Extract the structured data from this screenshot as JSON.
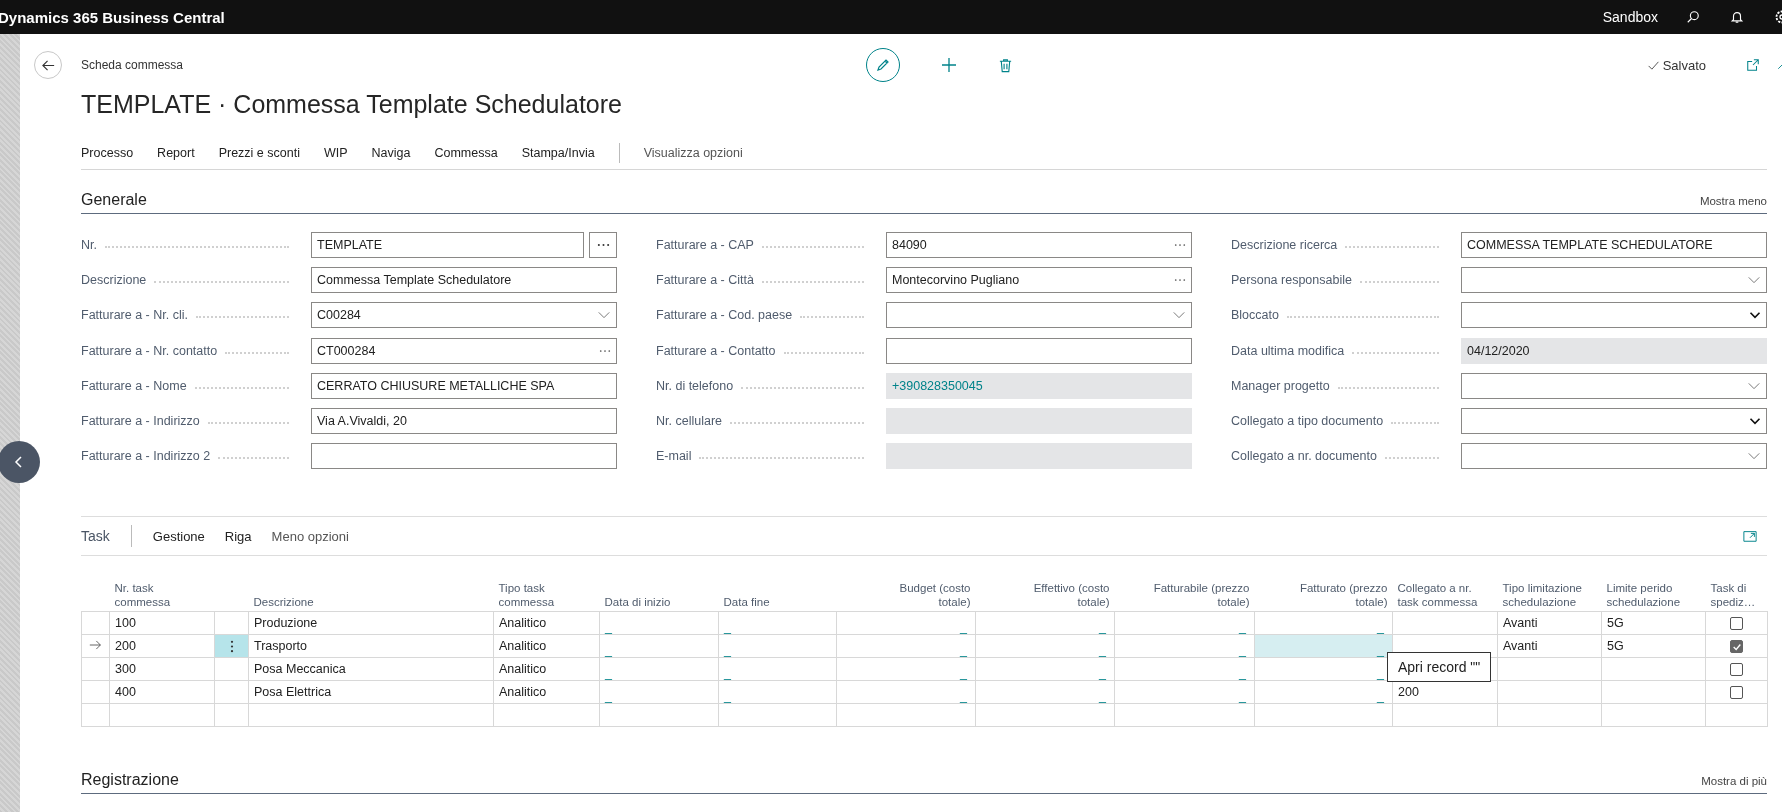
{
  "app_bar": {
    "product": "Dynamics 365 Business Central",
    "environment": "Sandbox"
  },
  "header": {
    "breadcrumb": "Scheda commessa",
    "title": "TEMPLATE · Commessa Template Schedulatore",
    "status": "Salvato"
  },
  "action_bar": {
    "actions": [
      "Processo",
      "Report",
      "Prezzi e sconti",
      "WIP",
      "Naviga",
      "Commessa",
      "Stampa/Invia"
    ],
    "options": "Visualizza opzioni"
  },
  "general": {
    "title": "Generale",
    "toggle": "Mostra meno",
    "columns": [
      [
        {
          "label": "Nr.",
          "value": "TEMPLATE",
          "kind": "assist_button"
        },
        {
          "label": "Descrizione",
          "value": "Commessa Template Schedulatore",
          "kind": "text"
        },
        {
          "label": "Fatturare a - Nr. cli.",
          "value": "C00284",
          "kind": "dropdown"
        },
        {
          "label": "Fatturare a - Nr. contatto",
          "value": "CT000284",
          "kind": "assist"
        },
        {
          "label": "Fatturare a - Nome",
          "value": "CERRATO CHIUSURE METALLICHE SPA",
          "kind": "text"
        },
        {
          "label": "Fatturare a - Indirizzo",
          "value": "Via A.Vivaldi, 20",
          "kind": "text"
        },
        {
          "label": "Fatturare a - Indirizzo 2",
          "kind": "text"
        }
      ],
      [
        {
          "label": "Fatturare a - CAP",
          "value": "84090",
          "kind": "assist"
        },
        {
          "label": "Fatturare a - Città",
          "value": "Montecorvino Pugliano",
          "kind": "assist"
        },
        {
          "label": "Fatturare a - Cod. paese",
          "kind": "dropdown"
        },
        {
          "label": "Fatturare a - Contatto",
          "kind": "text"
        },
        {
          "label": "Nr. di telefono",
          "value": "+390828350045",
          "kind": "readonly_link"
        },
        {
          "label": "Nr. cellulare",
          "kind": "readonly"
        },
        {
          "label": "E-mail",
          "kind": "readonly"
        }
      ],
      [
        {
          "label": "Descrizione ricerca",
          "value": "COMMESSA TEMPLATE SCHEDULATORE",
          "kind": "text"
        },
        {
          "label": "Persona responsabile",
          "kind": "dropdown"
        },
        {
          "label": "Bloccato",
          "kind": "select"
        },
        {
          "label": "Data ultima modifica",
          "value": "04/12/2020",
          "kind": "readonly"
        },
        {
          "label": "Manager progetto",
          "kind": "dropdown"
        },
        {
          "label": "Collegato a tipo documento",
          "kind": "select"
        },
        {
          "label": "Collegato a nr. documento",
          "kind": "dropdown"
        }
      ]
    ]
  },
  "task": {
    "title": "Task",
    "actions": [
      "Gestione",
      "Riga"
    ],
    "more": "Meno opzioni",
    "tooltip": "Apri record \"\"",
    "columns": [
      {
        "label": "Nr. task commessa",
        "kind": "text"
      },
      {
        "label": "Descrizione",
        "kind": "text"
      },
      {
        "label": "Tipo task commessa",
        "kind": "text"
      },
      {
        "label": "Data di inizio",
        "kind": "date"
      },
      {
        "label": "Data fine",
        "kind": "date"
      },
      {
        "label": "Budget (costo totale)",
        "kind": "amount"
      },
      {
        "label": "Effettivo (costo totale)",
        "kind": "amount"
      },
      {
        "label": "Fatturabile (prezzo totale)",
        "kind": "amount"
      },
      {
        "label": "Fatturato (prezzo totale)",
        "kind": "amount",
        "focused": true
      },
      {
        "label": "Collegato a nr. task commessa",
        "kind": "text"
      },
      {
        "label": "Tipo limitazione schedulazione",
        "kind": "text"
      },
      {
        "label": "Limite perido schedulazione",
        "kind": "text"
      },
      {
        "label": "Task di spediz…",
        "kind": "checkbox"
      }
    ],
    "rows": [
      {
        "selected": false,
        "no": "100",
        "description": "Produzione",
        "type": "Analitico",
        "start": "_",
        "end": "_",
        "budget": "_",
        "actual": "_",
        "billable": "_",
        "invoiced": "_",
        "limit_type": "Avanti",
        "limit_period": "5G",
        "shipping": false
      },
      {
        "selected": true,
        "no": "200",
        "description": "Trasporto",
        "type": "Analitico",
        "start": "_",
        "end": "_",
        "budget": "_",
        "actual": "_",
        "billable": "_",
        "invoiced": "_",
        "limit_type": "Avanti",
        "limit_period": "5G",
        "shipping": true
      },
      {
        "selected": false,
        "no": "300",
        "description": "Posa Meccanica",
        "type": "Analitico",
        "start": "_",
        "end": "_",
        "budget": "_",
        "actual": "_",
        "billable": "_",
        "invoiced": "_",
        "shipping": false
      },
      {
        "selected": false,
        "no": "400",
        "description": "Posa Elettrica",
        "type": "Analitico",
        "start": "_",
        "end": "_",
        "budget": "_",
        "actual": "_",
        "billable": "_",
        "invoiced": "_",
        "linked_task": "200",
        "shipping": false
      }
    ]
  },
  "posting": {
    "title": "Registrazione",
    "toggle": "Mostra di più"
  }
}
